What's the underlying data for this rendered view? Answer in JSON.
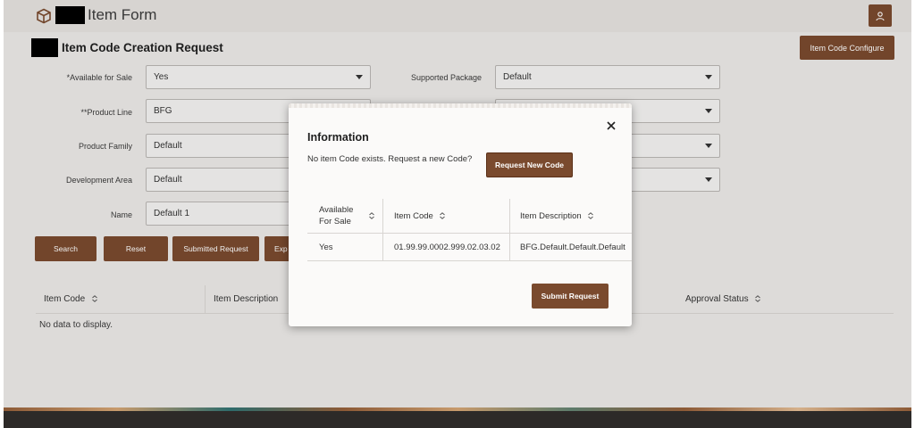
{
  "header": {
    "app_title": "Item Form"
  },
  "section": {
    "title": "Item Code Creation Request",
    "configure_label": "Item Code Configure"
  },
  "form": {
    "available_for_sale": {
      "label": "*Available for Sale",
      "value": "Yes"
    },
    "product_line": {
      "label": "**Product Line",
      "value": "BFG"
    },
    "product_family": {
      "label": "Product Family",
      "value": "Default"
    },
    "development_area": {
      "label": "Development Area",
      "value": "Default"
    },
    "name": {
      "label": "Name",
      "value": "Default 1"
    },
    "supported_package": {
      "label": "Supported Package",
      "value": "Default"
    }
  },
  "actions": {
    "search": "Search",
    "reset": "Reset",
    "submitted": "Submitted Request",
    "export": "Exp"
  },
  "table": {
    "columns": [
      "Item Code",
      "Item Description",
      "Approval Status"
    ],
    "empty_text": "No data to display."
  },
  "modal": {
    "title": "Information",
    "message": "No item Code exists. Request a new Code?",
    "request_label": "Request New Code",
    "columns": [
      "Available For Sale",
      "Item Code",
      "Item Description"
    ],
    "rows": [
      {
        "available": "Yes",
        "code": "01.99.99.0002.999.02.03.02",
        "description": "BFG.Default.Default.Default"
      }
    ],
    "submit_label": "Submit Request"
  }
}
